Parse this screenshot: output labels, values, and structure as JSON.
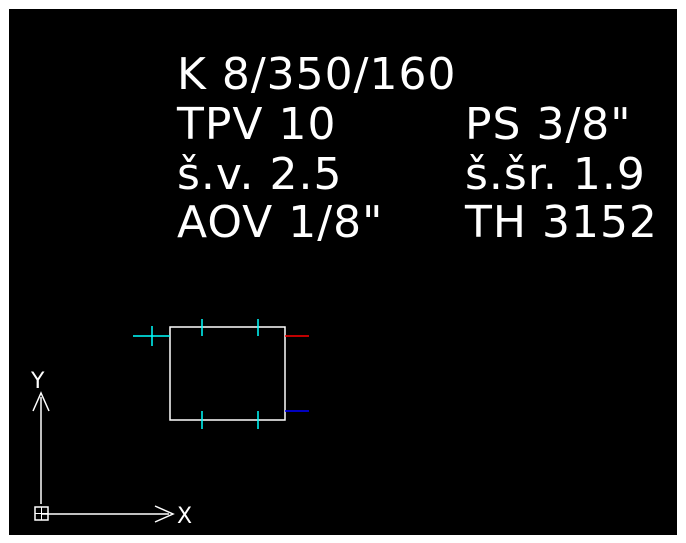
{
  "annotation": {
    "line1": "K 8/350/160",
    "tpv_label": "TPV 10",
    "ps_label": "PS 3/8\"",
    "sv_label": "š.v. 2.5",
    "ssr_label": "š.šr. 1.9",
    "aov_label": "AOV 1/8\"",
    "th_label": "TH 3152"
  },
  "ucs": {
    "x_label": "X",
    "y_label": "Y"
  },
  "colors": {
    "background": "#000000",
    "text": "#ffffff",
    "outline": "#ffffff",
    "ticks": "#00ffff",
    "supply": "#ff0000",
    "return": "#0000ff"
  }
}
